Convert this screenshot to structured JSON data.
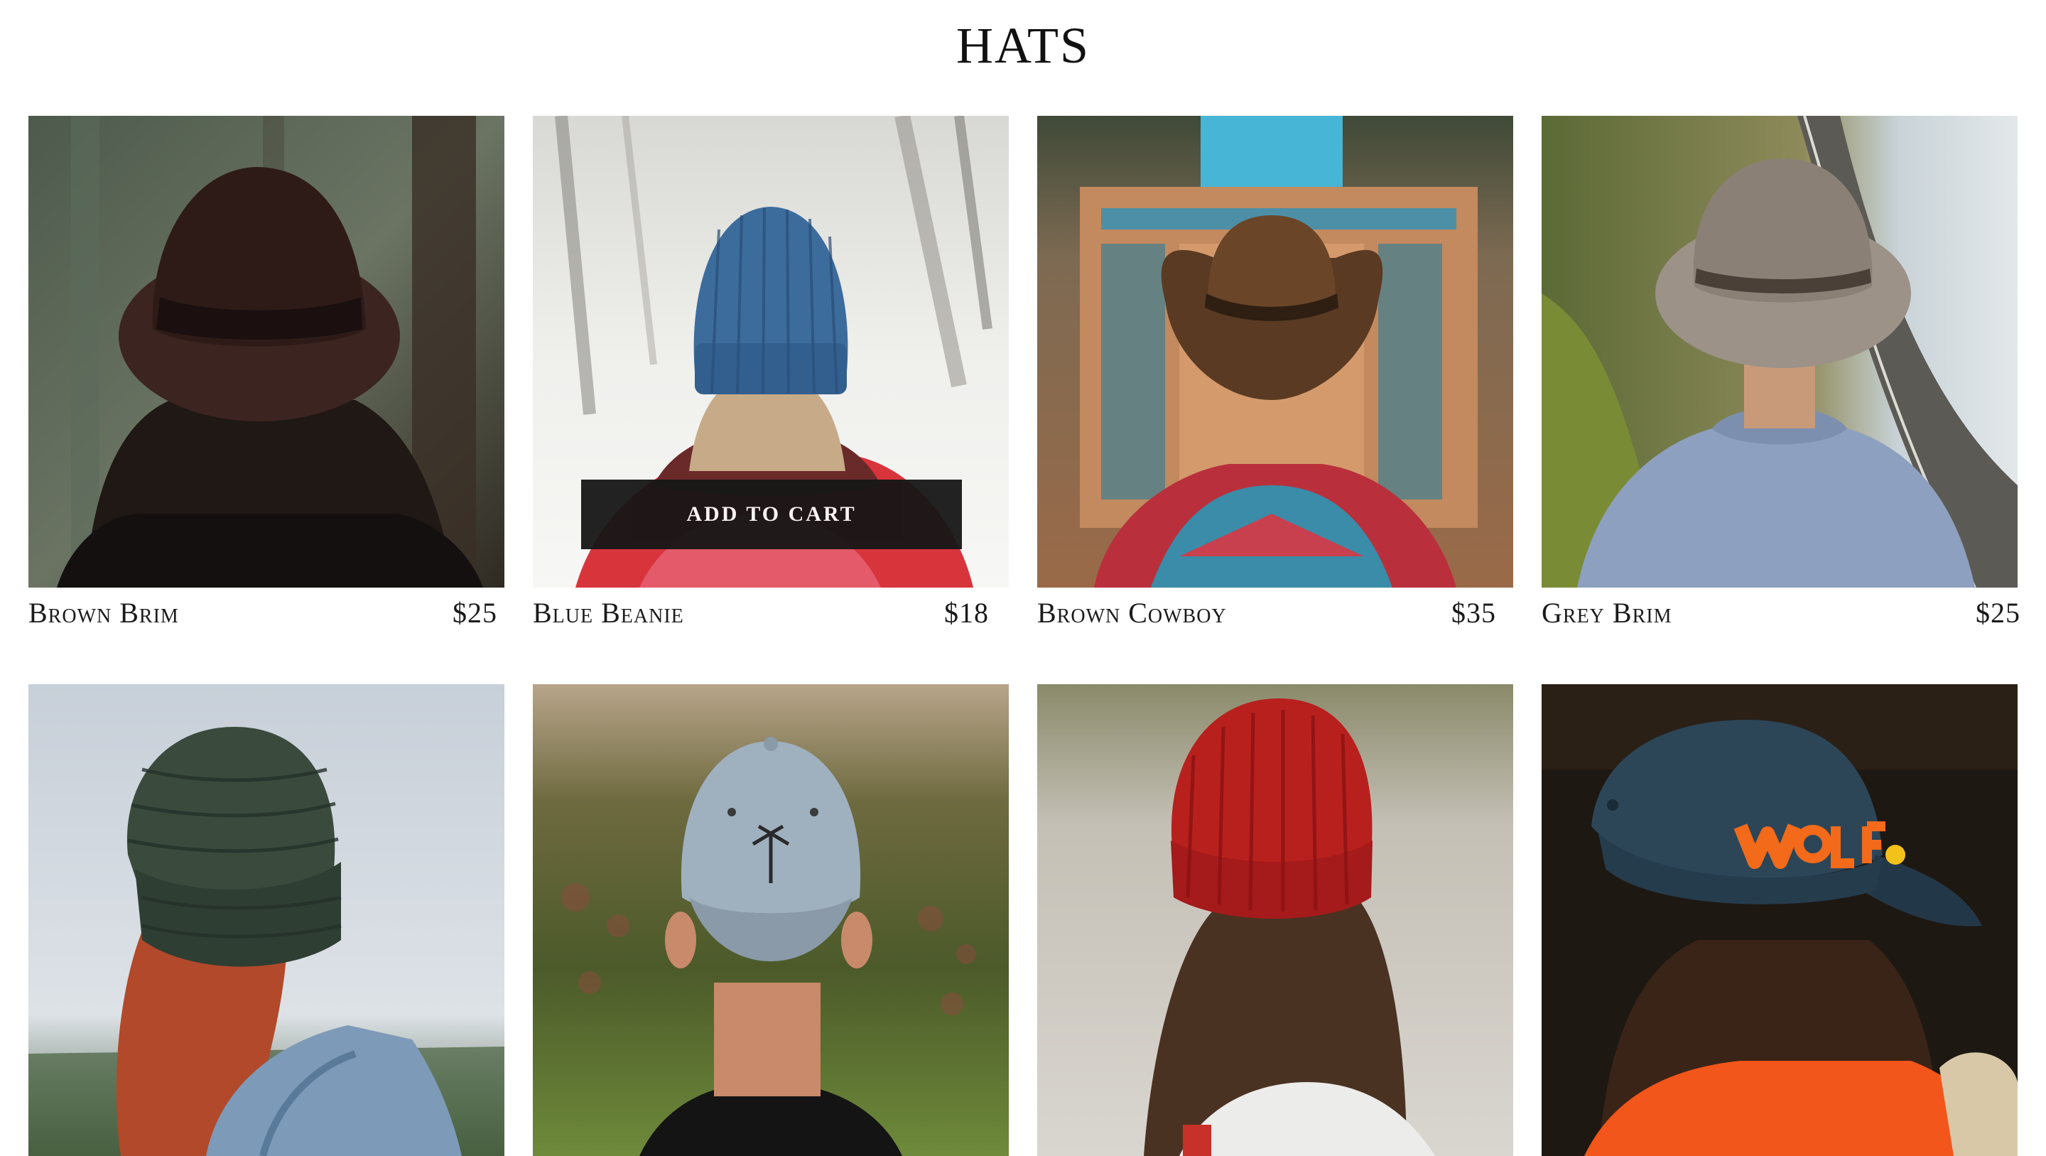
{
  "page": {
    "title": "HATS"
  },
  "hover_action": {
    "label": "ADD TO CART"
  },
  "products": [
    {
      "name": "Brown Brim",
      "price": "$25",
      "image": "brown-fedora-photo"
    },
    {
      "name": "Blue Beanie",
      "price": "$18",
      "image": "blue-beanie-photo"
    },
    {
      "name": "Brown Cowboy",
      "price": "$35",
      "image": "brown-cowboy-hat-photo"
    },
    {
      "name": "Grey Brim",
      "price": "$25",
      "image": "grey-brim-hat-photo"
    },
    {
      "name": "",
      "price": "",
      "image": "green-knit-beanie-photo"
    },
    {
      "name": "",
      "price": "",
      "image": "grey-palm-cap-photo"
    },
    {
      "name": "",
      "price": "",
      "image": "red-beanie-photo"
    },
    {
      "name": "",
      "price": "",
      "image": "wolf-cap-photo"
    }
  ],
  "colors": {
    "background": "#ffffff",
    "text": "#111111",
    "button_bg": "#161616",
    "button_text": "#ffffff"
  }
}
